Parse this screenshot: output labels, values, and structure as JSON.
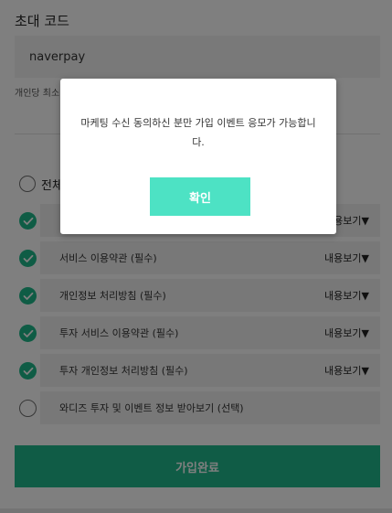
{
  "referral": {
    "title": "초대 코드",
    "value": "naverpay",
    "note": "개인당 최소"
  },
  "agreement": {
    "all_label": "전체",
    "view_more_label": "내용보기▼",
    "terms": [
      {
        "label": "",
        "checked": true,
        "view_more": true
      },
      {
        "label": "서비스 이용약관 (필수)",
        "checked": true,
        "view_more": true
      },
      {
        "label": "개인정보 처리방침 (필수)",
        "checked": true,
        "view_more": true
      },
      {
        "label": "투자 서비스 이용약관 (필수)",
        "checked": true,
        "view_more": true
      },
      {
        "label": "투자 개인정보 처리방침 (필수)",
        "checked": true,
        "view_more": true
      },
      {
        "label": "와디즈 투자 및 이벤트 정보 받아보기 (선택)",
        "checked": false,
        "view_more": false
      }
    ]
  },
  "submit_label": "가입완료",
  "dialog": {
    "message": "마케팅 수신 동의하신 분만 가입 이벤트 응모가 가능합니다.",
    "confirm_label": "확인"
  },
  "colors": {
    "accent": "#21b88c",
    "check": "#1fb88a",
    "confirm": "#4de2c4"
  }
}
